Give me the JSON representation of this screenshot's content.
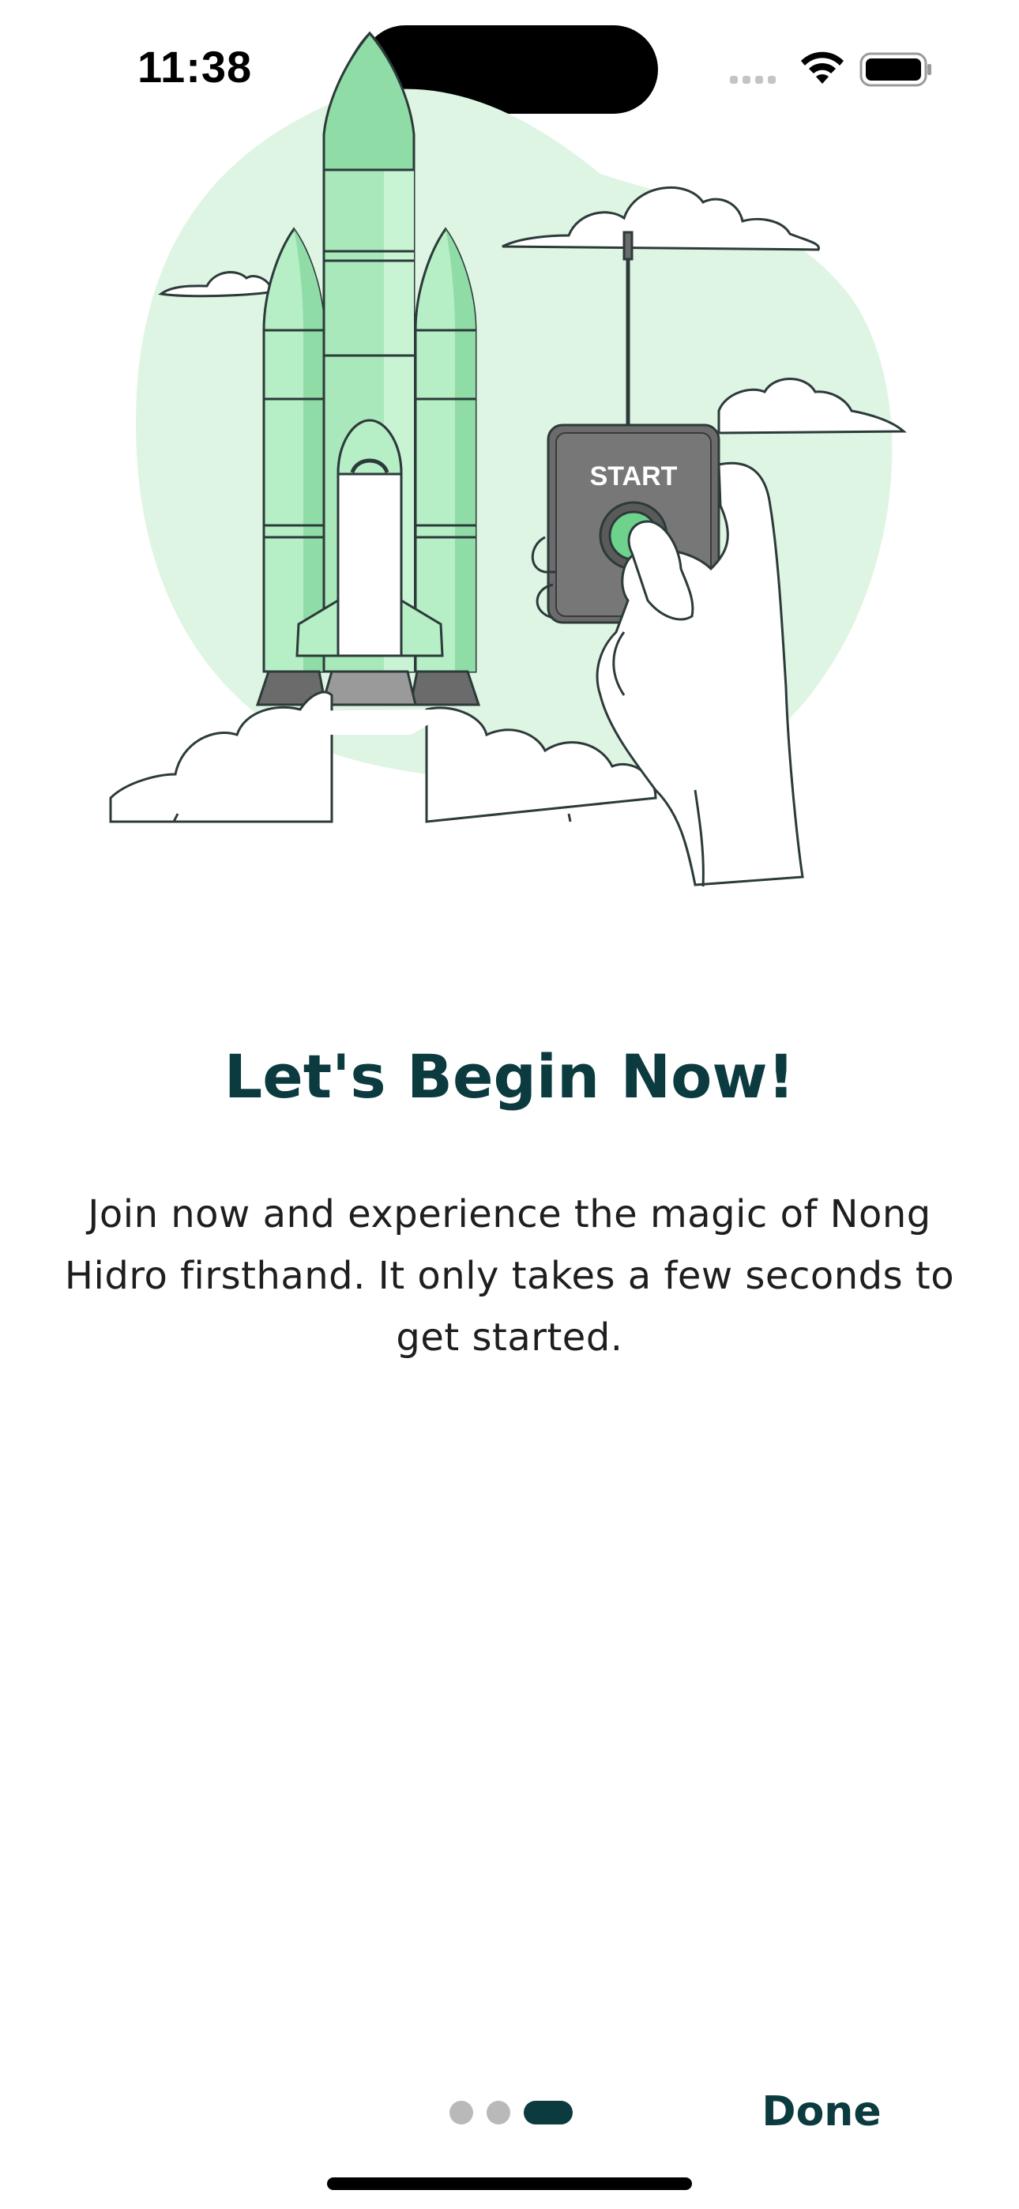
{
  "status_bar": {
    "time": "11:38"
  },
  "illustration": {
    "remote_label": "START",
    "colors": {
      "blob": "#dff5e3",
      "rocket_green": "#b6eec6",
      "rocket_dark_green": "#8fdca6",
      "remote_gray": "#6b6b6b",
      "remote_button": "#6fd28c"
    }
  },
  "onboarding": {
    "title": "Let's Begin Now!",
    "description": "Join now and experience the magic of Nong Hidro firsthand. It only takes a few seconds to get started."
  },
  "pager": {
    "total_pages": 3,
    "current_page": 3
  },
  "done_label": "Done",
  "colors": {
    "accent": "#0b3a3f",
    "dot_inactive": "#b9b9b9"
  }
}
